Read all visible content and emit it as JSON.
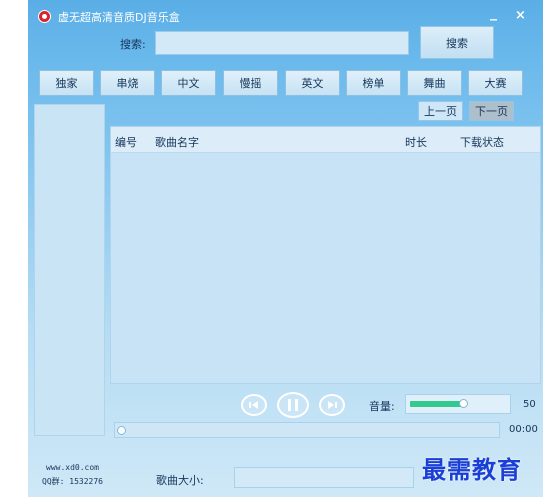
{
  "window": {
    "title": "虚无超高清音质DJ音乐盒",
    "minimize": "_",
    "close": "×"
  },
  "search": {
    "label": "搜索:",
    "value": "",
    "placeholder": "",
    "button": "搜索"
  },
  "categories": [
    "独家",
    "串烧",
    "中文",
    "慢摇",
    "英文",
    "榜单",
    "舞曲",
    "大赛"
  ],
  "paging": {
    "prev": "上一页",
    "next": "下一页"
  },
  "list": {
    "columns": {
      "number": "编号",
      "name": "歌曲名字",
      "duration": "时长",
      "status": "下载状态"
    },
    "rows": []
  },
  "player": {
    "volume_label": "音量:",
    "volume_value": "50",
    "volume_level": 0.5,
    "time": "00:00",
    "progress": 0
  },
  "footer": {
    "site": "www.xd0.com",
    "qq": "QQ群: 1532276",
    "size_label": "歌曲大小:",
    "size_value": ""
  },
  "brand_watermark": "最需教育",
  "icons": [
    "logo-icon",
    "prev-track-icon",
    "pause-icon",
    "next-track-icon"
  ],
  "colors": {
    "window_top": "#5aaee6",
    "window_bottom": "#cfe8f7",
    "text": "#15365a",
    "volume_fill": "#33c98f",
    "brand": "#1a3fd6"
  }
}
